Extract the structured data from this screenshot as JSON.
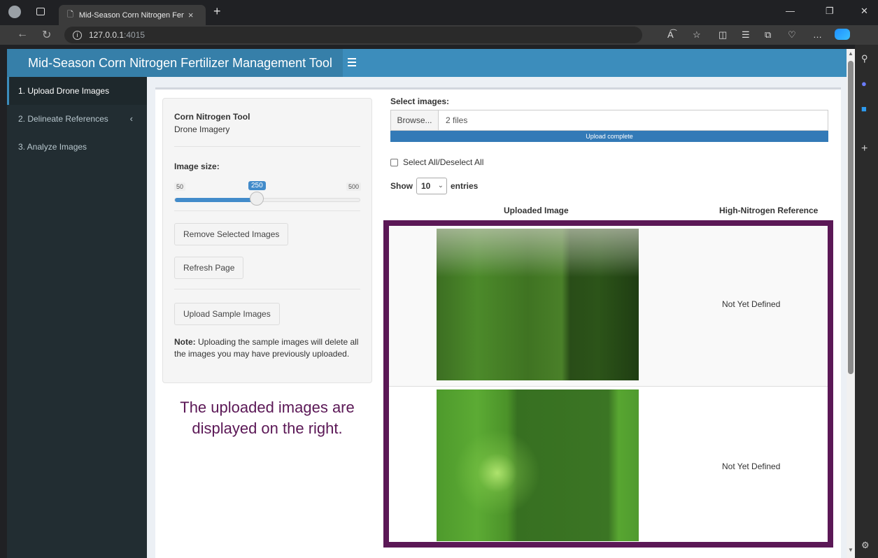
{
  "browser": {
    "tab_title": "Mid-Season Corn Nitrogen Fertili",
    "tab_close": "×",
    "new_tab": "+",
    "url_host": "127.0.0.1",
    "url_port": ":4015",
    "window_controls": [
      "—",
      "❐",
      "✕"
    ]
  },
  "app": {
    "title": "Mid-Season Corn Nitrogen Fertilizer Management Tool"
  },
  "sidebar": {
    "items": [
      {
        "label": "1. Upload Drone Images",
        "active": true
      },
      {
        "label": "2. Delineate References",
        "active": false,
        "icon": "chevron-left-icon"
      },
      {
        "label": "3. Analyze Images",
        "active": false
      }
    ]
  },
  "panel": {
    "title": "Corn Nitrogen Tool",
    "subtitle": "Drone Imagery",
    "slider_label": "Image size:",
    "slider_min": "50",
    "slider_max": "500",
    "slider_value": "250",
    "slider_fraction": 0.444,
    "remove_button": "Remove Selected Images",
    "refresh_button": "Refresh Page",
    "sample_button": "Upload Sample Images",
    "note_bold": "Note:",
    "note_text": " Uploading the sample images will delete all the images you may have previously uploaded."
  },
  "caption": "The uploaded images are displayed on the right.",
  "upload": {
    "label": "Select images:",
    "browse": "Browse...",
    "file_count": "2 files",
    "progress_text": "Upload complete"
  },
  "table": {
    "select_all": "Select All/Deselect All",
    "show_label": "Show",
    "entries_value": "10",
    "entries_label": "entries",
    "columns": [
      "Uploaded Image",
      "High-Nitrogen Reference"
    ],
    "rows": [
      {
        "reference": "Not Yet Defined"
      },
      {
        "reference": "Not Yet Defined"
      }
    ]
  },
  "colors": {
    "header": "#3c8dbc",
    "sidebar": "#222d32",
    "highlight_frame": "#5b1856",
    "progress": "#337ab7"
  }
}
